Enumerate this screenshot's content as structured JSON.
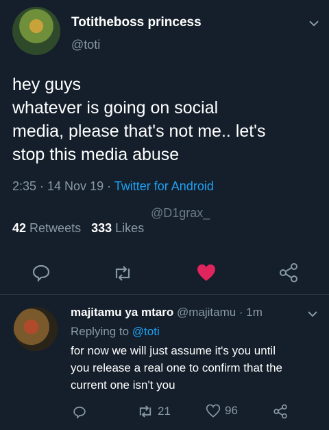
{
  "tweet": {
    "display_name": "Totitheboss princess",
    "handle": "@toti",
    "lines": [
      "hey guys",
      "whatever is going on social",
      "media, please that's not me.. let's",
      "stop this media abuse"
    ],
    "time_date": "2:35 · 14 Nov 19 ·",
    "source": "Twitter for Android",
    "watermark": "@D1grax_",
    "retweets_count": "42",
    "retweets_label": "Retweets",
    "likes_count": "333",
    "likes_label": "Likes"
  },
  "reply": {
    "display_name": "majitamu ya mtaro",
    "meta": "@majitamu · 1m",
    "replying_prefix": "Replying to",
    "replying_handle": "@toti",
    "lines": [
      "for now we will just assume it's you until",
      "you release a real one to confirm that the",
      "current one isn't you"
    ],
    "retweet_count": "21",
    "like_count": "96"
  },
  "colors": {
    "background": "#151f2b",
    "link": "#1da1f2",
    "muted": "#8899a6",
    "like": "#e0245e"
  },
  "icons": [
    "chevron-down-icon",
    "reply-icon",
    "retweet-icon",
    "heart-icon",
    "share-icon"
  ]
}
